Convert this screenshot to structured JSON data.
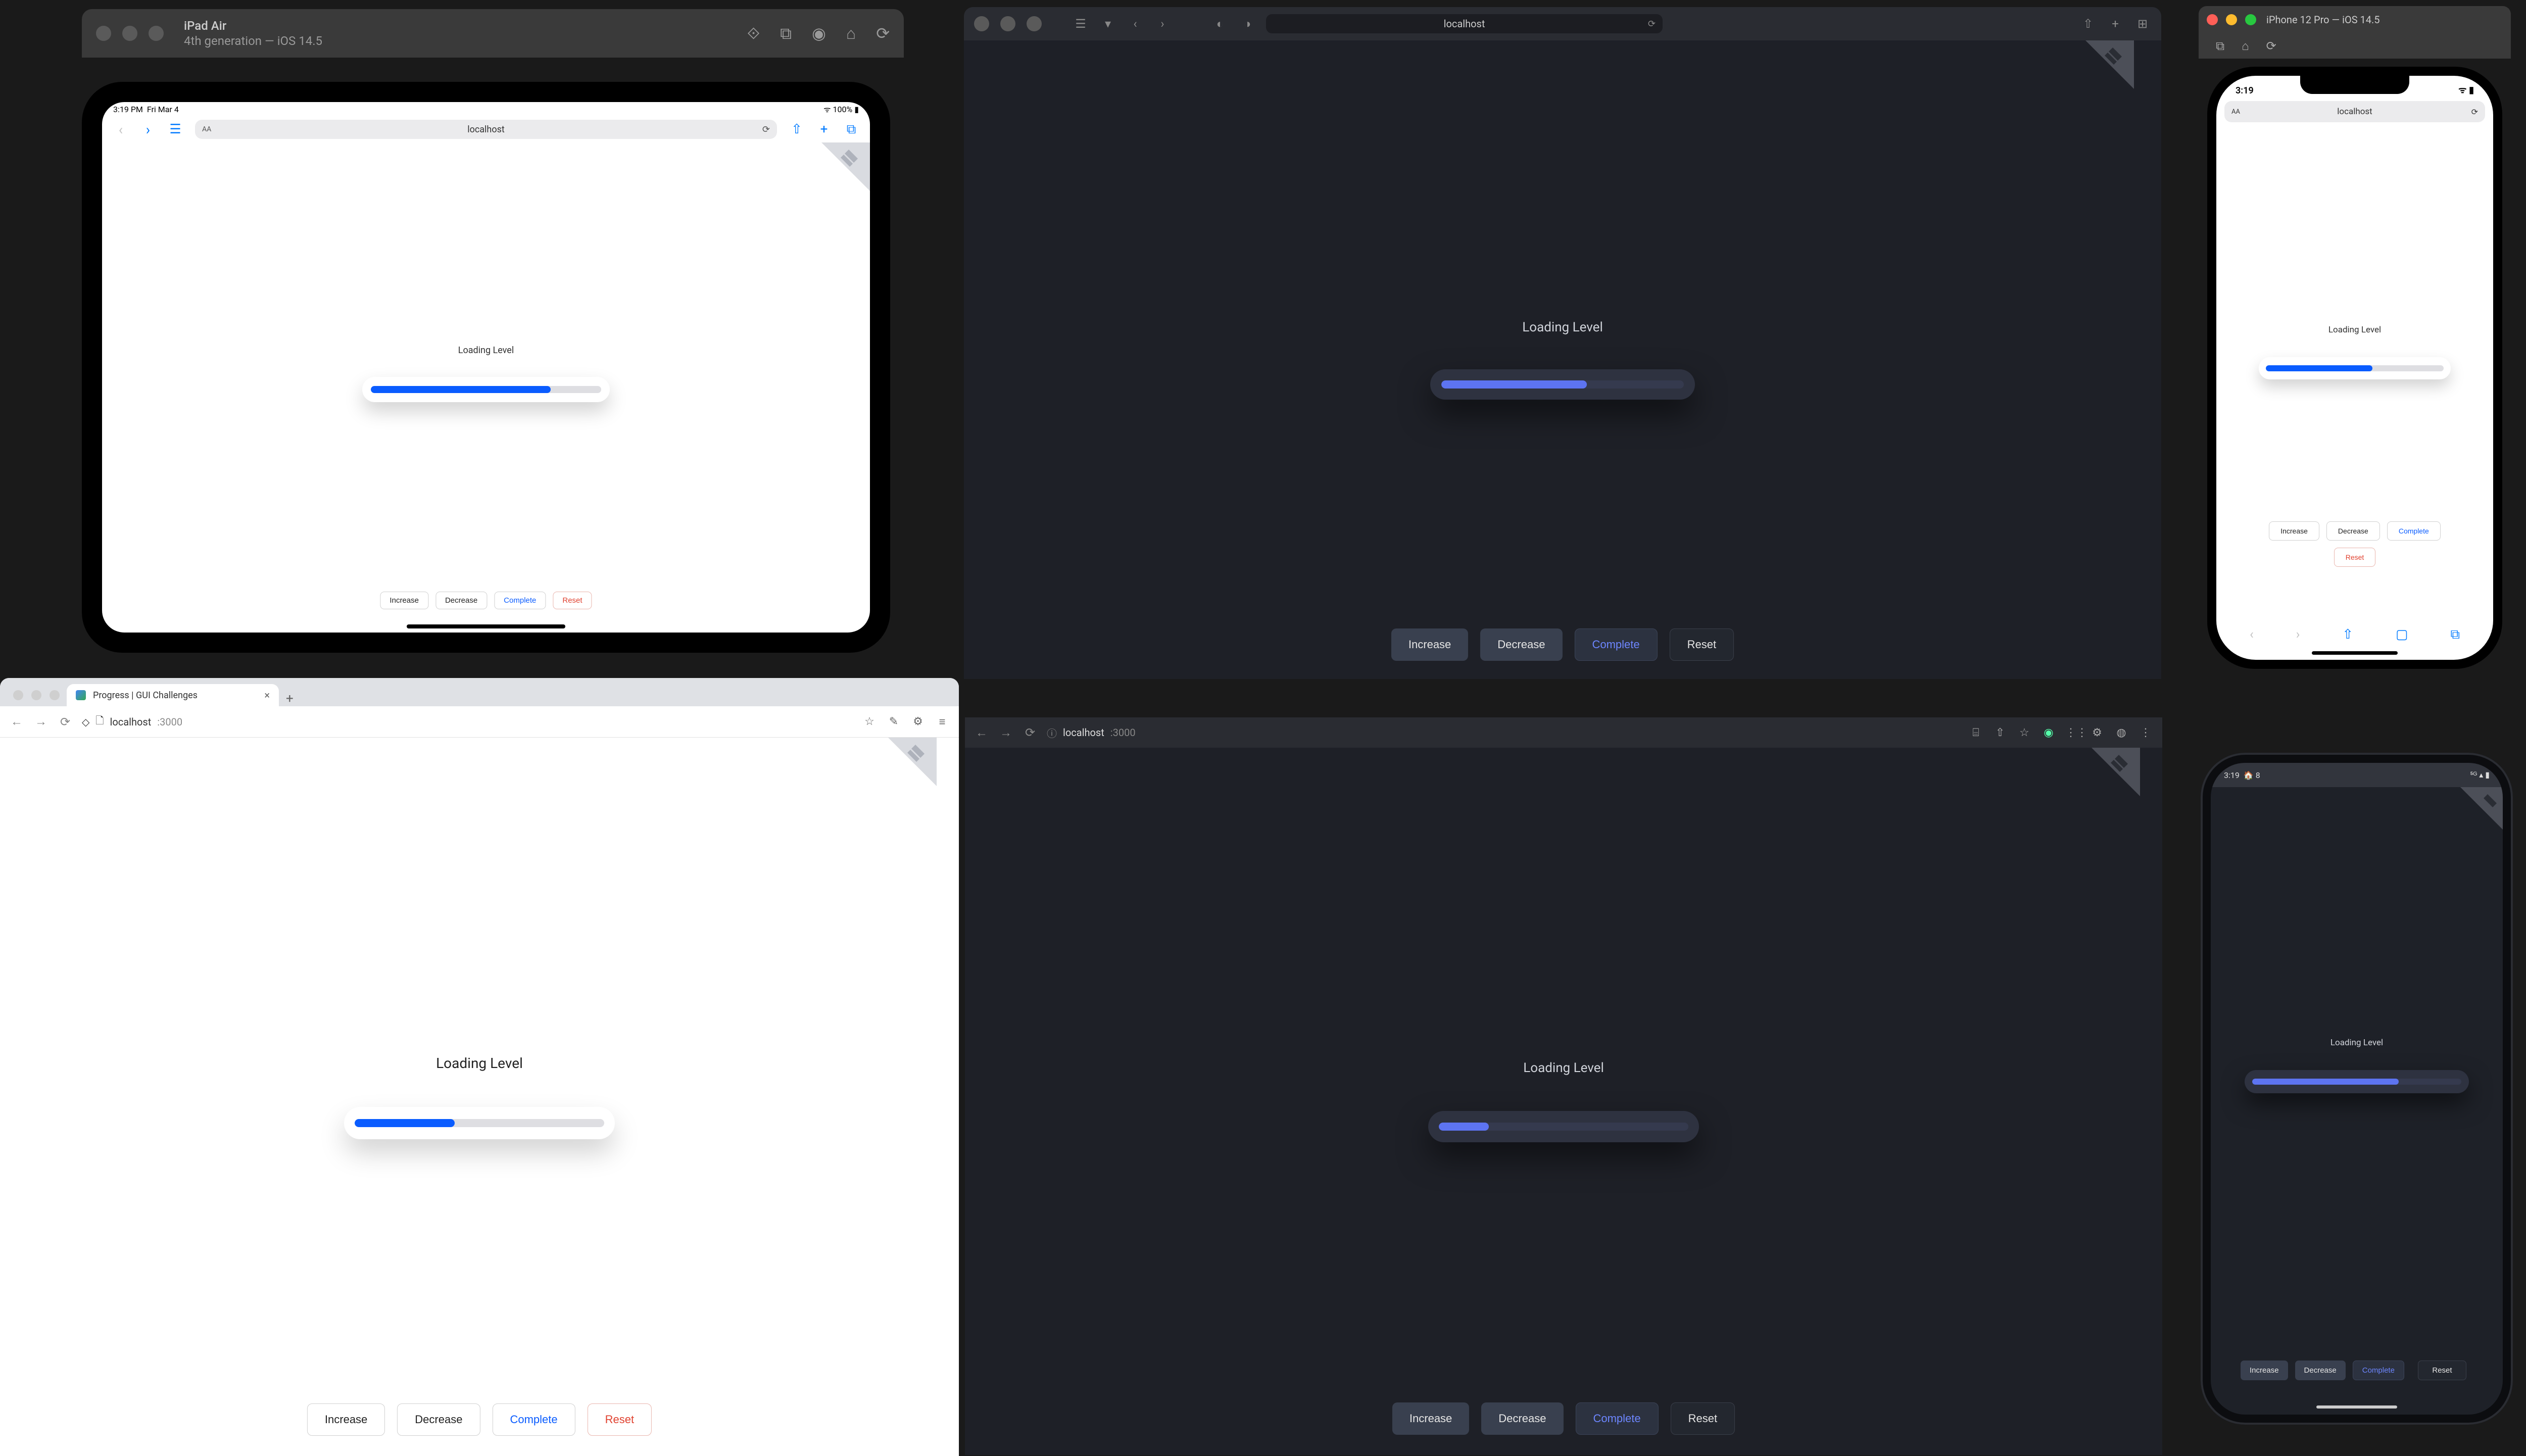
{
  "app": {
    "heading": "Loading Level",
    "buttons": {
      "increase": "Increase",
      "decrease": "Decrease",
      "complete": "Complete",
      "reset": "Reset"
    }
  },
  "ipad": {
    "title": "iPad Air",
    "subtitle": "4th generation — iOS 14.5",
    "status_time": "3:19 PM",
    "status_date": "Fri Mar 4",
    "status_right": "100%",
    "url": "localhost",
    "progress_pct": 78
  },
  "safari_main": {
    "url": "localhost",
    "progress_pct": 60
  },
  "iphone": {
    "title": "iPhone 12 Pro — iOS 14.5",
    "status_time": "3:19",
    "url": "localhost",
    "progress_pct": 60
  },
  "chrome_light": {
    "tab_title": "Progress | GUI Challenges",
    "url_host": "localhost",
    "url_port": ":3000",
    "progress_pct": 40
  },
  "chrome_dark": {
    "url_host": "localhost",
    "url_port": ":3000",
    "progress_pct": 20
  },
  "android": {
    "status_time": "3:19",
    "status_extra": "8",
    "progress_pct": 70
  }
}
